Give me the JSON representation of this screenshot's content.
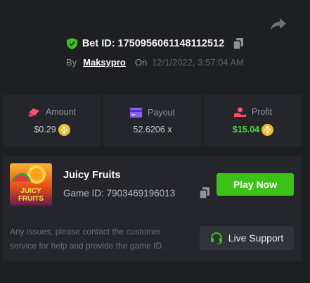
{
  "bet": {
    "label": "Bet ID:",
    "id": "1750956061148112512",
    "by_label": "By",
    "username": "Maksypro",
    "on_label": "On",
    "date": "12/1/2022, 3:57:04 AM"
  },
  "stats": {
    "amount": {
      "label": "Amount",
      "value": "$0.29",
      "icon": "amount-icon"
    },
    "payout": {
      "label": "Payout",
      "value": "52.6206 x",
      "icon": "payout-icon"
    },
    "profit": {
      "label": "Profit",
      "value": "$15.04",
      "icon": "profit-icon"
    }
  },
  "game": {
    "title": "Juicy Fruits",
    "id_label": "Game ID:",
    "id": "7903469196013",
    "thumb_text_1": "JUICY",
    "thumb_text_2": "FRUITS",
    "play_label": "Play Now"
  },
  "support": {
    "notice": "Any issues, please contact the customer service for help and provide the game ID.",
    "button_label": "Live Support"
  },
  "colors": {
    "background": "#1e1f23",
    "panel": "#25262b",
    "accent_green": "#3bc117",
    "profit_green": "#4bd934",
    "coin_gold": "#f3ba2f"
  }
}
